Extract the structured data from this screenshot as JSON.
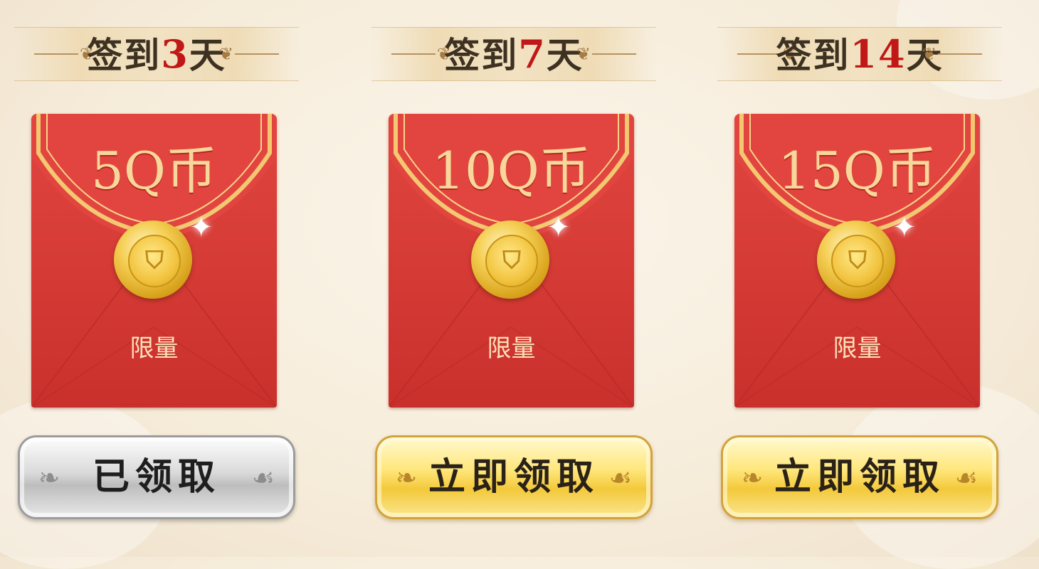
{
  "rewards": [
    {
      "header_prefix": "签到",
      "days": "3",
      "header_suffix": "天",
      "amount": "5Q币",
      "badge": "限量",
      "button_label": "已领取",
      "state": "claimed"
    },
    {
      "header_prefix": "签到",
      "days": "7",
      "header_suffix": "天",
      "amount": "10Q币",
      "badge": "限量",
      "button_label": "立即领取",
      "state": "available"
    },
    {
      "header_prefix": "签到",
      "days": "14",
      "header_suffix": "天",
      "amount": "15Q币",
      "badge": "限量",
      "button_label": "立即领取",
      "state": "available"
    }
  ],
  "colors": {
    "envelope_red": "#d53a35",
    "gold_text": "#f8d79a",
    "day_number_red": "#c01717",
    "active_button_gold": "#f3c93b",
    "claimed_button_silver": "#bdbdbd"
  },
  "icons": {
    "seal": "gold-coin-seal-icon",
    "ornament": "fleur-ornament-icon",
    "sparkle": "sparkle-icon"
  }
}
